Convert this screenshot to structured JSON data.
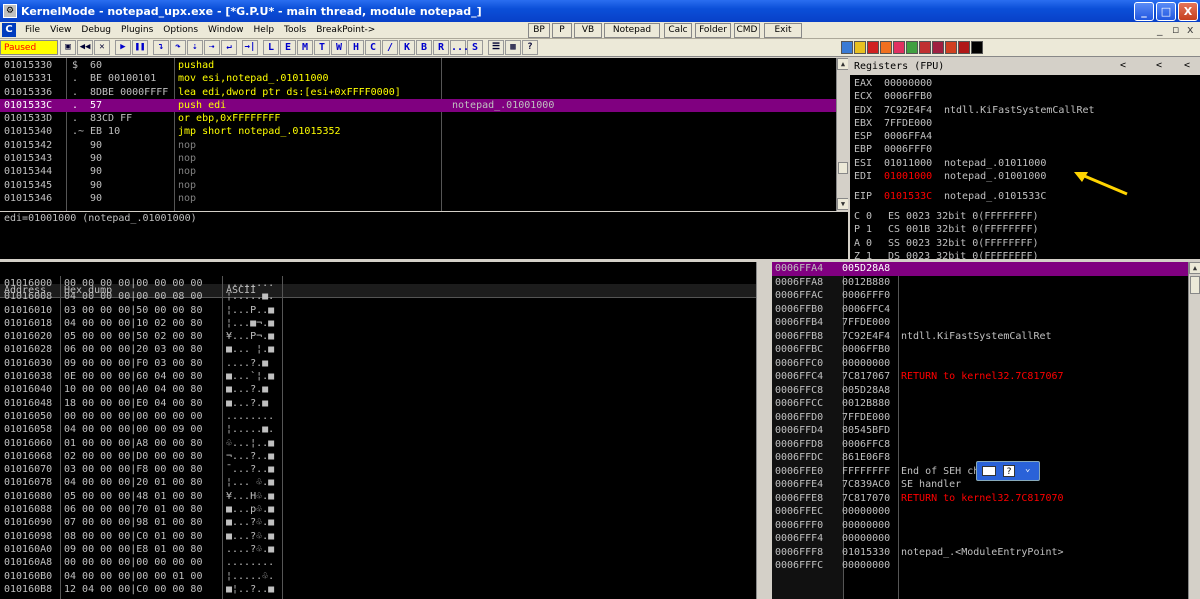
{
  "titlebar": {
    "title": "KernelMode - notepad_upx.exe - [*G.P.U* - main thread, module notepad_]",
    "minimize": "_",
    "maximize": "□",
    "close": "X"
  },
  "menu": {
    "items": [
      "File",
      "View",
      "Debug",
      "Plugins",
      "Options",
      "Window",
      "Help",
      "Tools",
      "BreakPoint->"
    ],
    "quick_buttons": [
      "BP",
      "P",
      "VB",
      "Notepad",
      "Calc",
      "Folder",
      "CMD",
      "Exit"
    ],
    "mdi_controls": [
      "_",
      "▫",
      "x"
    ]
  },
  "toolbar": {
    "status": "Paused",
    "letters": [
      "L",
      "E",
      "M",
      "T",
      "W",
      "H",
      "C",
      "/",
      "K",
      "B",
      "R",
      "...",
      "S"
    ]
  },
  "disasm": {
    "rows": [
      {
        "addr": "01015330",
        "mark": "$",
        "hex": "60",
        "instr": "pushad",
        "comment": "",
        "selected": false
      },
      {
        "addr": "01015331",
        "mark": ".",
        "hex": "BE 00100101",
        "instr": "mov esi,notepad_.01011000",
        "comment": "",
        "selected": false
      },
      {
        "addr": "01015336",
        "mark": ".",
        "hex": "8DBE 0000FFFF",
        "instr": "lea edi,dword ptr ds:[esi+0xFFFF0000]",
        "comment": "",
        "selected": false
      },
      {
        "addr": "0101533C",
        "mark": ".",
        "hex": "57",
        "instr": "push edi",
        "comment": "notepad_.01001000",
        "selected": true
      },
      {
        "addr": "0101533D",
        "mark": ".",
        "hex": "83CD FF",
        "instr": "or ebp,0xFFFFFFFF",
        "comment": "",
        "selected": false
      },
      {
        "addr": "01015340",
        "mark": ".~",
        "hex": "EB 10",
        "instr": "jmp short notepad_.01015352",
        "comment": "",
        "selected": false
      },
      {
        "addr": "01015342",
        "mark": "",
        "hex": "90",
        "instr": "nop",
        "comment": "",
        "selected": false
      },
      {
        "addr": "01015343",
        "mark": "",
        "hex": "90",
        "instr": "nop",
        "comment": "",
        "selected": false
      },
      {
        "addr": "01015344",
        "mark": "",
        "hex": "90",
        "instr": "nop",
        "comment": "",
        "selected": false
      },
      {
        "addr": "01015345",
        "mark": "",
        "hex": "90",
        "instr": "nop",
        "comment": "",
        "selected": false
      },
      {
        "addr": "01015346",
        "mark": "",
        "hex": "90",
        "instr": "nop",
        "comment": "",
        "selected": false
      }
    ],
    "info": "edi=01001000 (notepad_.01001000)"
  },
  "registers": {
    "header": "Registers (FPU)",
    "nav": [
      "<",
      "<",
      "<"
    ],
    "rows": [
      {
        "name": "EAX",
        "value": "00000000",
        "comment": "",
        "changed": false
      },
      {
        "name": "ECX",
        "value": "0006FFB0",
        "comment": "",
        "changed": false
      },
      {
        "name": "EDX",
        "value": "7C92E4F4",
        "comment": "ntdll.KiFastSystemCallRet",
        "changed": false
      },
      {
        "name": "EBX",
        "value": "7FFDE000",
        "comment": "",
        "changed": false
      },
      {
        "name": "ESP",
        "value": "0006FFA4",
        "comment": "",
        "changed": false
      },
      {
        "name": "EBP",
        "value": "0006FFF0",
        "comment": "",
        "changed": false
      },
      {
        "name": "ESI",
        "value": "01011000",
        "comment": "notepad_.01011000",
        "changed": false
      },
      {
        "name": "EDI",
        "value": "01001000",
        "comment": "notepad_.01001000",
        "changed": true
      },
      {
        "name": "EIP",
        "value": "0101533C",
        "comment": "notepad_.0101533C",
        "changed": true
      }
    ],
    "segments": [
      {
        "flag": "C 0",
        "seg": "ES 0023 32bit 0(FFFFFFFF)"
      },
      {
        "flag": "P 1",
        "seg": "CS 001B 32bit 0(FFFFFFFF)"
      },
      {
        "flag": "A 0",
        "seg": "SS 0023 32bit 0(FFFFFFFF)"
      },
      {
        "flag": "Z 1",
        "seg": "DS 0023 32bit 0(FFFFFFFF)"
      }
    ]
  },
  "dump": {
    "headers": [
      "Address",
      "Hex dump",
      "ASCII"
    ],
    "rows": [
      {
        "addr": "01016000",
        "hex": "00 00 00 00|00 00 00 00",
        "ascii": "........"
      },
      {
        "addr": "01016008",
        "hex": "04 00 00 00|00 00 08 00",
        "ascii": "¦.....■."
      },
      {
        "addr": "01016010",
        "hex": "03 00 00 00|50 00 00 80",
        "ascii": "¦...P..■"
      },
      {
        "addr": "01016018",
        "hex": "04 00 00 00|10 02 00 80",
        "ascii": "¦...■¬.■"
      },
      {
        "addr": "01016020",
        "hex": "05 00 00 00|50 02 00 80",
        "ascii": "¥...P¬.■"
      },
      {
        "addr": "01016028",
        "hex": "06 00 00 00|20 03 00 80",
        "ascii": "■... ¦.■"
      },
      {
        "addr": "01016030",
        "hex": "09 00 00 00|F0 03 00 80",
        "ascii": "....?.■"
      },
      {
        "addr": "01016038",
        "hex": "0E 00 00 00|60 04 00 80",
        "ascii": "■...`¦.■"
      },
      {
        "addr": "01016040",
        "hex": "10 00 00 00|A0 04 00 80",
        "ascii": "■...?.■"
      },
      {
        "addr": "01016048",
        "hex": "18 00 00 00|E0 04 00 80",
        "ascii": "■...?.■"
      },
      {
        "addr": "01016050",
        "hex": "00 00 00 00|00 00 00 00",
        "ascii": "........"
      },
      {
        "addr": "01016058",
        "hex": "04 00 00 00|00 00 09 00",
        "ascii": "¦.....■."
      },
      {
        "addr": "01016060",
        "hex": "01 00 00 00|A8 00 00 80",
        "ascii": "♧...¦..■"
      },
      {
        "addr": "01016068",
        "hex": "02 00 00 00|D0 00 00 80",
        "ascii": "¬...?..■"
      },
      {
        "addr": "01016070",
        "hex": "03 00 00 00|F8 00 00 80",
        "ascii": "¯...?..■"
      },
      {
        "addr": "01016078",
        "hex": "04 00 00 00|20 01 00 80",
        "ascii": "¦... ♧.■"
      },
      {
        "addr": "01016080",
        "hex": "05 00 00 00|48 01 00 80",
        "ascii": "¥...H♧.■"
      },
      {
        "addr": "01016088",
        "hex": "06 00 00 00|70 01 00 80",
        "ascii": "■...p♧.■"
      },
      {
        "addr": "01016090",
        "hex": "07 00 00 00|98 01 00 80",
        "ascii": "■...?♧.■"
      },
      {
        "addr": "01016098",
        "hex": "08 00 00 00|C0 01 00 80",
        "ascii": "■...?♧.■"
      },
      {
        "addr": "010160A0",
        "hex": "09 00 00 00|E8 01 00 80",
        "ascii": "....?♧.■"
      },
      {
        "addr": "010160A8",
        "hex": "00 00 00 00|00 00 00 00",
        "ascii": "........"
      },
      {
        "addr": "010160B0",
        "hex": "04 00 00 00|00 00 01 00",
        "ascii": "¦.....♧."
      },
      {
        "addr": "010160B8",
        "hex": "12 04 00 00|C0 00 00 80",
        "ascii": "■¦..?..■"
      }
    ]
  },
  "stack": {
    "rows": [
      {
        "addr": "0006FFA4",
        "value": "005D28A8",
        "comment": "",
        "red": false,
        "selected": true
      },
      {
        "addr": "0006FFA8",
        "value": "0012B880",
        "comment": "",
        "red": false,
        "selected": false
      },
      {
        "addr": "0006FFAC",
        "value": "0006FFF0",
        "comment": "",
        "red": false,
        "selected": false
      },
      {
        "addr": "0006FFB0",
        "value": "0006FFC4",
        "comment": "",
        "red": false,
        "selected": false
      },
      {
        "addr": "0006FFB4",
        "value": "7FFDE000",
        "comment": "",
        "red": false,
        "selected": false
      },
      {
        "addr": "0006FFB8",
        "value": "7C92E4F4",
        "comment": "ntdll.KiFastSystemCallRet",
        "red": false,
        "selected": false
      },
      {
        "addr": "0006FFBC",
        "value": "0006FFB0",
        "comment": "",
        "red": false,
        "selected": false
      },
      {
        "addr": "0006FFC0",
        "value": "00000000",
        "comment": "",
        "red": false,
        "selected": false
      },
      {
        "addr": "0006FFC4",
        "value": "7C817067",
        "comment": "RETURN to kernel32.7C817067",
        "red": true,
        "selected": false
      },
      {
        "addr": "0006FFC8",
        "value": "005D28A8",
        "comment": "",
        "red": false,
        "selected": false
      },
      {
        "addr": "0006FFCC",
        "value": "0012B880",
        "comment": "",
        "red": false,
        "selected": false
      },
      {
        "addr": "0006FFD0",
        "value": "7FFDE000",
        "comment": "",
        "red": false,
        "selected": false
      },
      {
        "addr": "0006FFD4",
        "value": "80545BFD",
        "comment": "",
        "red": false,
        "selected": false
      },
      {
        "addr": "0006FFD8",
        "value": "0006FFC8",
        "comment": "",
        "red": false,
        "selected": false
      },
      {
        "addr": "0006FFDC",
        "value": "861E06F8",
        "comment": "",
        "red": false,
        "selected": false
      },
      {
        "addr": "0006FFE0",
        "value": "FFFFFFFF",
        "comment": "End of SEH chain",
        "red": false,
        "selected": false
      },
      {
        "addr": "0006FFE4",
        "value": "7C839AC0",
        "comment": "SE handler",
        "red": false,
        "selected": false
      },
      {
        "addr": "0006FFE8",
        "value": "7C817070",
        "comment": "RETURN to kernel32.7C817070",
        "red": true,
        "selected": false
      },
      {
        "addr": "0006FFEC",
        "value": "00000000",
        "comment": "",
        "red": false,
        "selected": false
      },
      {
        "addr": "0006FFF0",
        "value": "00000000",
        "comment": "",
        "red": false,
        "selected": false
      },
      {
        "addr": "0006FFF4",
        "value": "00000000",
        "comment": "",
        "red": false,
        "selected": false
      },
      {
        "addr": "0006FFF8",
        "value": "01015330",
        "comment": "notepad_.<ModuleEntryPoint>",
        "red": false,
        "selected": false
      },
      {
        "addr": "0006FFFC",
        "value": "00000000",
        "comment": "",
        "red": false,
        "selected": false
      }
    ]
  },
  "colors": {
    "selection": "#800080",
    "changed_register": "#ff0000",
    "annotation_arrow": "#ffd400"
  }
}
